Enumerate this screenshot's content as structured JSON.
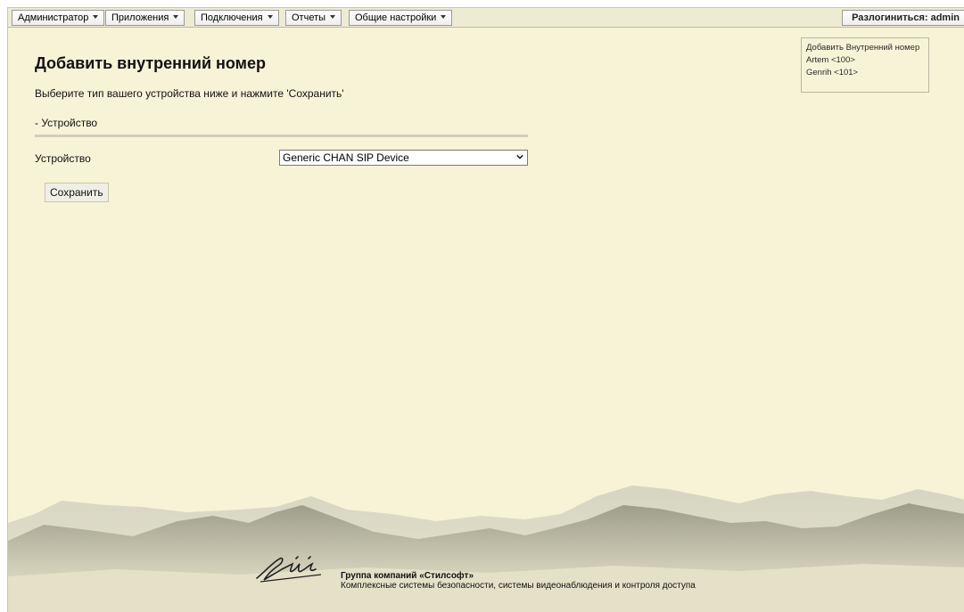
{
  "menu": {
    "items": [
      {
        "label": "Администратор"
      },
      {
        "label": "Приложения"
      },
      {
        "label": "Подключения"
      },
      {
        "label": "Отчеты"
      },
      {
        "label": "Общие настройки"
      }
    ],
    "logout_label": "Разлогиниться: admin"
  },
  "page": {
    "title": "Добавить внутренний номер",
    "instructions": "Выберите тип вашего устройства ниже и нажмите 'Сохранить'",
    "section_label": "- Устройство",
    "device_label": "Устройство",
    "device_value": "Generic CHAN SIP Device",
    "save_label": "Сохранить"
  },
  "extensions_panel": {
    "add_label": "Добавить Внутренний номер",
    "items": [
      {
        "label": "Artem <100>"
      },
      {
        "label": "Genrih <101>"
      }
    ]
  },
  "footer": {
    "company": "Группа компаний «Стилсофт»",
    "tagline": "Комплексные системы безопасности, системы видеонаблюдения и контроля доступа",
    "logo_name": "stilsoft-logo"
  },
  "colors": {
    "background": "#f7f3d6",
    "menubar": "#eeebd3"
  }
}
